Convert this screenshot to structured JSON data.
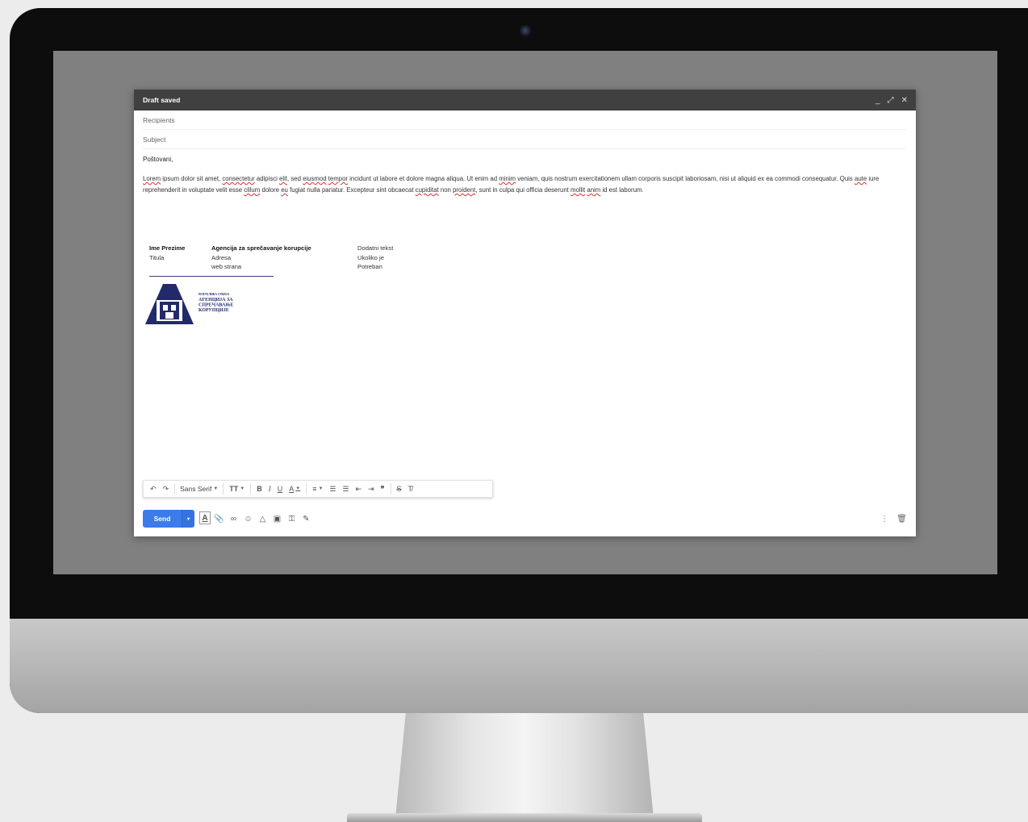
{
  "window": {
    "title": "Draft saved",
    "minimize": "_",
    "expand": "⤢",
    "close": "✕"
  },
  "fields": {
    "recipients": "Recipients",
    "subject": "Subject"
  },
  "body": {
    "greeting": "Poštovani,",
    "paragraph": [
      {
        "t": "Lorem",
        "s": true
      },
      {
        "t": " ipsum dolor sit amet, "
      },
      {
        "t": "consectetur",
        "s": true
      },
      {
        "t": " adipisci "
      },
      {
        "t": "elit",
        "s": true
      },
      {
        "t": ", sed "
      },
      {
        "t": "eiusmod",
        "s": true
      },
      {
        "t": " "
      },
      {
        "t": "tempor",
        "s": true
      },
      {
        "t": " incidunt ut labore et dolore magna aliqua. Ut enim ad "
      },
      {
        "t": "minim",
        "s": true
      },
      {
        "t": " veniam, quis nostrum exercitationem ullam corporis suscipit laboriosam, nisi ut aliquid ex ea commodi consequatur. Quis "
      },
      {
        "t": "aute",
        "s": true
      },
      {
        "t": " iure reprehenderit in voluptate velit esse "
      },
      {
        "t": "cillum",
        "s": true
      },
      {
        "t": " dolore "
      },
      {
        "t": "eu",
        "s": true
      },
      {
        "t": " fugiat nulla pariatur. Excepteur sint obcaecat "
      },
      {
        "t": "cupiditat",
        "s": true
      },
      {
        "t": " non "
      },
      {
        "t": "proident",
        "s": true
      },
      {
        "t": ", sunt in culpa qui officia deserunt "
      },
      {
        "t": "mollit",
        "s": true
      },
      {
        "t": " "
      },
      {
        "t": "anim",
        "s": true
      },
      {
        "t": " id est laborum."
      }
    ]
  },
  "signature": {
    "name": "Ime Prezime",
    "title": "Titula",
    "org": "Agencija za sprečavanje korupcije",
    "address": "Adresa",
    "web": "web strana",
    "extra1": "Dodatni tekst",
    "extra2": "Ukoliko je",
    "extra3": "Potreban",
    "logo_text": [
      "РЕПУБЛИКА СРБИЈА",
      "АГЕНЦИЈА ЗА",
      "СПРЕЧАВАЊЕ",
      "КОРУПЦИЈЕ"
    ],
    "logo_color": "#232a6b"
  },
  "toolbar": {
    "undo": "↶",
    "redo": "↷",
    "font": "Sans Serif",
    "size": "TT",
    "bold": "B",
    "italic": "I",
    "underline": "U",
    "text_color": "A",
    "align": "≡",
    "numbered_list": "☰",
    "bulleted_list": "☰",
    "indent_less": "⇤",
    "indent_more": "⇥",
    "quote": "❞",
    "strikethrough": "S",
    "remove_format": "T̸"
  },
  "actions": {
    "send": "Send",
    "send_more": "▾",
    "formatting": "A",
    "attach": "📎",
    "link": "∞",
    "emoji": "☺",
    "drive": "△",
    "photo": "▣",
    "confidential": "⚿",
    "signature": "✎",
    "more": "⋮",
    "discard": "🗑"
  },
  "colors": {
    "accent": "#3b7bea",
    "titlebar": "#404040",
    "spell": "#d9302c"
  }
}
